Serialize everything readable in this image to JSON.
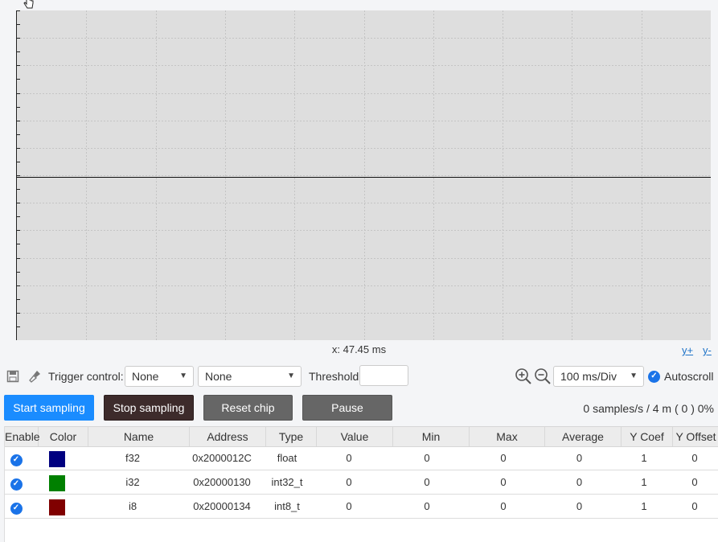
{
  "plot": {
    "x_readout": "x: 47.45 ms",
    "y_plus": "y+",
    "y_minus": "y-"
  },
  "toolbar": {
    "save_icon": "save-icon",
    "clear_icon": "broom-icon",
    "trigger_label": "Trigger control:",
    "trigger_channel": "None",
    "trigger_mode": "None",
    "threshold_label": "Threshold:",
    "threshold_value": "",
    "zoom_in_icon": "zoom-in-icon",
    "zoom_out_icon": "zoom-out-icon",
    "time_div": "100 ms/Div",
    "autoscroll_label": "Autoscroll",
    "autoscroll_checked": true
  },
  "buttons": {
    "start": "Start sampling",
    "stop": "Stop sampling",
    "reset": "Reset chip",
    "pause": "Pause"
  },
  "status": {
    "samples": "0 samples/s / 4 m ( 0  ) 0%"
  },
  "colors": {
    "start_button": "#1a8cff",
    "stop_button": "#3d2b2b",
    "gray_button": "#666666",
    "f32": "#000080",
    "i32": "#008000",
    "i8": "#800000"
  },
  "table": {
    "headers": [
      "Enable",
      "Color",
      "Name",
      "Address",
      "Type",
      "Value",
      "Min",
      "Max",
      "Average",
      "Y Coef",
      "Y Offset"
    ],
    "rows": [
      {
        "enabled": true,
        "color": "#000080",
        "name": "f32",
        "address": "0x2000012C",
        "type": "float",
        "value": "0",
        "min": "0",
        "max": "0",
        "average": "0",
        "ycoef": "1",
        "yoffset": "0"
      },
      {
        "enabled": true,
        "color": "#008000",
        "name": "i32",
        "address": "0x20000130",
        "type": "int32_t",
        "value": "0",
        "min": "0",
        "max": "0",
        "average": "0",
        "ycoef": "1",
        "yoffset": "0"
      },
      {
        "enabled": true,
        "color": "#800000",
        "name": "i8",
        "address": "0x20000134",
        "type": "int8_t",
        "value": "0",
        "min": "0",
        "max": "0",
        "average": "0",
        "ycoef": "1",
        "yoffset": "0"
      }
    ]
  }
}
